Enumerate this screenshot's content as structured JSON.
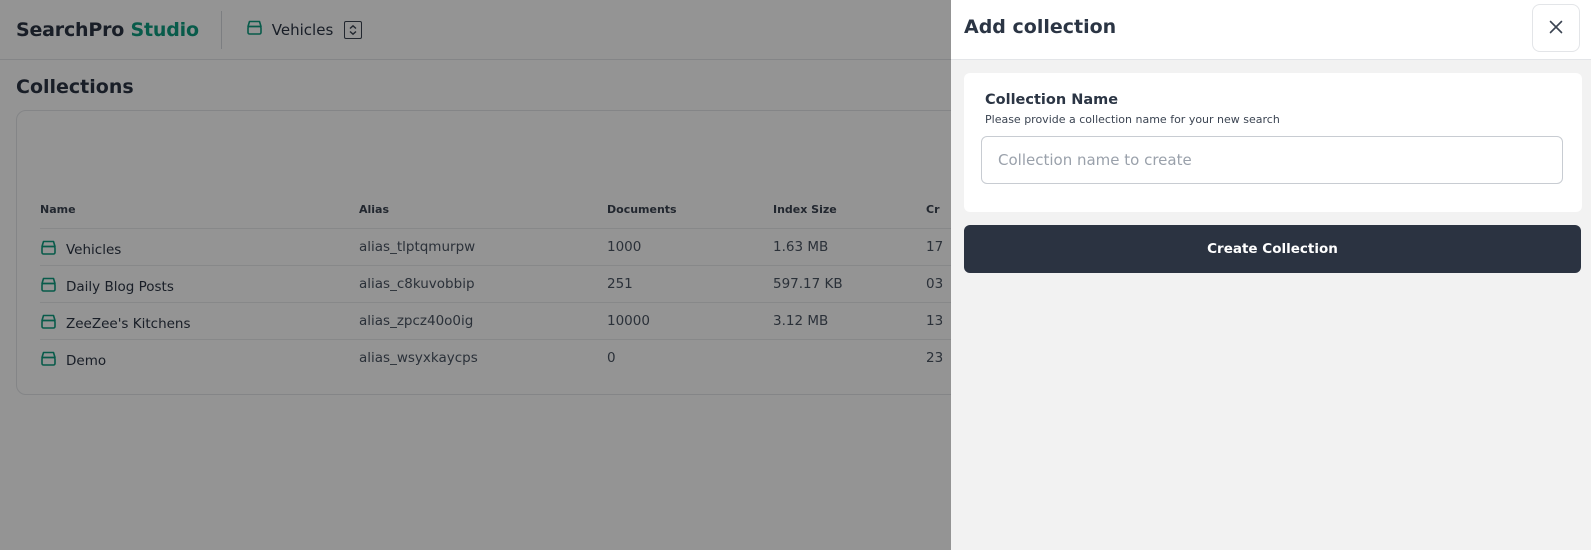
{
  "app": {
    "brand_primary": "SearchPro",
    "brand_accent": "Studio",
    "accent_color": "#0f9d80"
  },
  "header": {
    "current_collection": "Vehicles",
    "collection_icon": "collection-box-icon",
    "switch_icon": "chevron-up-down-icon"
  },
  "page": {
    "title": "Collections"
  },
  "table": {
    "columns": [
      "Name",
      "Alias",
      "Documents",
      "Index Size",
      "Cr"
    ],
    "rows": [
      {
        "name": "Vehicles",
        "alias": "alias_tlptqmurpw",
        "documents": "1000",
        "index_size": "1.63 MB",
        "created": "17"
      },
      {
        "name": "Daily Blog Posts",
        "alias": "alias_c8kuvobbip",
        "documents": "251",
        "index_size": "597.17 KB",
        "created": "03"
      },
      {
        "name": "ZeeZee's Kitchens",
        "alias": "alias_zpcz40o0ig",
        "documents": "10000",
        "index_size": "3.12 MB",
        "created": "13"
      },
      {
        "name": "Demo",
        "alias": "alias_wsyxkaycps",
        "documents": "0",
        "index_size": "",
        "created": "23"
      }
    ]
  },
  "drawer": {
    "title": "Add collection",
    "close_icon": "close-icon",
    "field_label": "Collection Name",
    "field_help": "Please provide a collection name for your new search",
    "field_value": "",
    "field_placeholder": "Collection name to create",
    "submit_label": "Create Collection"
  }
}
